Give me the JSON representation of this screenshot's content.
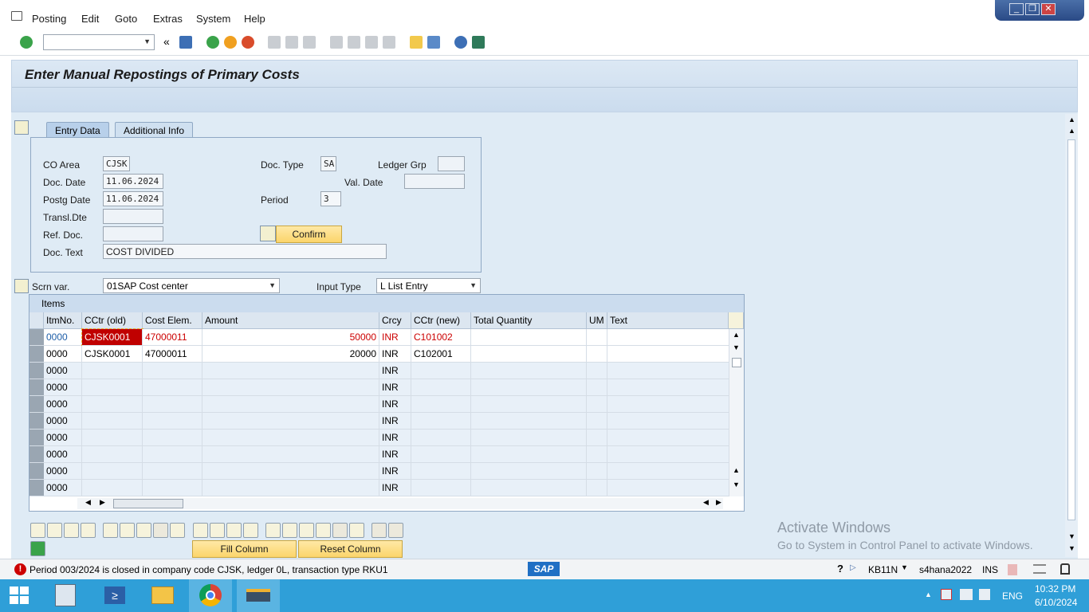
{
  "menu": {
    "items": [
      "Posting",
      "Edit",
      "Goto",
      "Extras",
      "System",
      "Help"
    ]
  },
  "window_controls": {
    "minimize": "_",
    "restore": "❐",
    "close": "✕"
  },
  "toolbar": {
    "command_field_value": "",
    "back_chevrons": "«"
  },
  "page": {
    "title": "Enter Manual Repostings of Primary Costs"
  },
  "tabs": [
    {
      "label": "Entry Data",
      "active": true
    },
    {
      "label": "Additional Info",
      "active": false
    }
  ],
  "header_fields": {
    "co_area": {
      "label": "CO Area",
      "value": "CJSK"
    },
    "doc_date": {
      "label": "Doc. Date",
      "value": "11.06.2024"
    },
    "postg_date": {
      "label": "Postg Date",
      "value": "11.06.2024"
    },
    "transl_date": {
      "label": "Transl.Dte",
      "value": ""
    },
    "ref_doc": {
      "label": "Ref. Doc.",
      "value": ""
    },
    "doc_text": {
      "label": "Doc. Text",
      "value": "COST DIVIDED"
    },
    "doc_type": {
      "label": "Doc. Type",
      "value": "SA"
    },
    "period": {
      "label": "Period",
      "value": "3"
    },
    "ledger_grp": {
      "label": "Ledger Grp",
      "value": ""
    },
    "val_date": {
      "label": "Val. Date",
      "value": ""
    }
  },
  "confirm_button": "Confirm",
  "screen_variant": {
    "label": "Scrn var.",
    "value": "01SAP Cost center"
  },
  "input_type": {
    "label": "Input Type",
    "value": "L List Entry"
  },
  "items_table": {
    "caption": "Items",
    "columns": [
      "ItmNo.",
      "CCtr (old)",
      "Cost Elem.",
      "Amount",
      "Crcy",
      "CCtr (new)",
      "Total Quantity",
      "UM",
      "Text"
    ],
    "rows": [
      {
        "itm": "0000",
        "cctr_old": "CJSK0001",
        "cost_elem": "47000011",
        "amount": "50000",
        "crcy": "INR",
        "cctr_new": "C101002",
        "qty": "",
        "um": "",
        "text": ""
      },
      {
        "itm": "0000",
        "cctr_old": "CJSK0001",
        "cost_elem": "47000011",
        "amount": "20000",
        "crcy": "INR",
        "cctr_new": "C102001",
        "qty": "",
        "um": "",
        "text": ""
      },
      {
        "itm": "0000",
        "cctr_old": "",
        "cost_elem": "",
        "amount": "",
        "crcy": "INR",
        "cctr_new": "",
        "qty": "",
        "um": "",
        "text": ""
      },
      {
        "itm": "0000",
        "cctr_old": "",
        "cost_elem": "",
        "amount": "",
        "crcy": "INR",
        "cctr_new": "",
        "qty": "",
        "um": "",
        "text": ""
      },
      {
        "itm": "0000",
        "cctr_old": "",
        "cost_elem": "",
        "amount": "",
        "crcy": "INR",
        "cctr_new": "",
        "qty": "",
        "um": "",
        "text": ""
      },
      {
        "itm": "0000",
        "cctr_old": "",
        "cost_elem": "",
        "amount": "",
        "crcy": "INR",
        "cctr_new": "",
        "qty": "",
        "um": "",
        "text": ""
      },
      {
        "itm": "0000",
        "cctr_old": "",
        "cost_elem": "",
        "amount": "",
        "crcy": "INR",
        "cctr_new": "",
        "qty": "",
        "um": "",
        "text": ""
      },
      {
        "itm": "0000",
        "cctr_old": "",
        "cost_elem": "",
        "amount": "",
        "crcy": "INR",
        "cctr_new": "",
        "qty": "",
        "um": "",
        "text": ""
      },
      {
        "itm": "0000",
        "cctr_old": "",
        "cost_elem": "",
        "amount": "",
        "crcy": "INR",
        "cctr_new": "",
        "qty": "",
        "um": "",
        "text": ""
      },
      {
        "itm": "0000",
        "cctr_old": "",
        "cost_elem": "",
        "amount": "",
        "crcy": "INR",
        "cctr_new": "",
        "qty": "",
        "um": "",
        "text": ""
      }
    ]
  },
  "bottom_buttons": {
    "fill_column": "Fill Column",
    "reset_column": "Reset Column"
  },
  "watermark": {
    "line1": "Activate Windows",
    "line2": "Go to System in Control Panel to activate Windows."
  },
  "status": {
    "message": "Period 003/2024  is closed in company code CJSK, ledger 0L, transaction type RKU1",
    "tcode": "KB11N",
    "system": "s4hana2022",
    "mode": "INS",
    "sap_logo": "SAP"
  },
  "taskbar": {
    "language": "ENG",
    "time": "10:32 PM",
    "date": "6/10/2024"
  },
  "colors": {
    "accent": "#2f9fd8",
    "error": "#cc0000",
    "button": "#fbd56b"
  }
}
